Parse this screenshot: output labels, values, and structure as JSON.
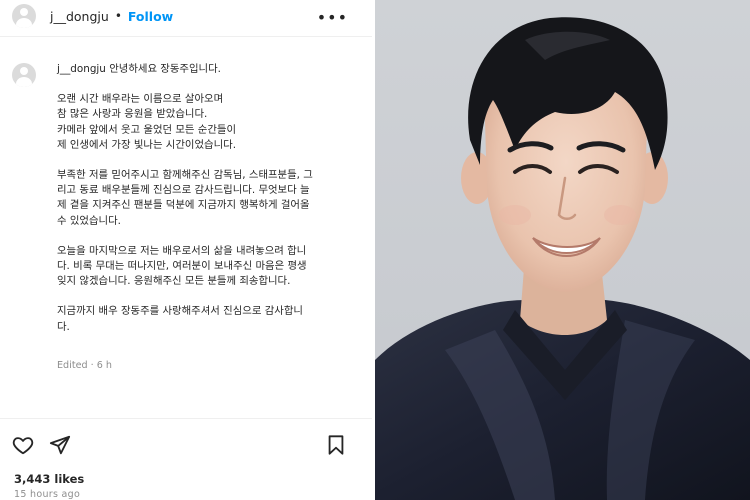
{
  "post": {
    "username": "j__dongju",
    "separator": "•",
    "follow_label": "Follow",
    "more_label": "•••",
    "caption_greeting": "안녕하세요 장동주입니다.",
    "paragraphs": [
      "오랜 시간 배우라는 이름으로 살아오며\n참 많은 사랑과 응원을 받았습니다.\n카메라 앞에서 웃고 울었던 모든 순간들이\n제 인생에서 가장 빛나는 시간이었습니다.",
      "부족한 저를 믿어주시고 함께해주신 감독님, 스태프분들, 그\n리고 동료 배우분들께 진심으로 감사드립니다. 무엇보다 늘\n제 곁을 지켜주신 팬분들 덕분에 지금까지 행복하게 걸어올\n수 있었습니다.",
      "오늘을 마지막으로 저는 배우로서의 삶을 내려놓으려 합니\n다. 비록 무대는 떠나지만, 여러분이 보내주신 마음은 평생\n잊지 않겠습니다. 응원해주신 모든 분들께 죄송합니다.",
      "지금까지 배우 장동주를 사랑해주셔서 진심으로 감사합니\n다."
    ],
    "edited": "Edited · 6 h",
    "likes": "3,443 likes",
    "time_ago": "15 hours ago"
  },
  "icons": {
    "avatar": "default-profile-icon",
    "like": "heart-icon",
    "share": "send-icon",
    "save": "bookmark-icon",
    "more": "more-options-icon"
  },
  "colors": {
    "accent": "#0095f6",
    "text": "#262626",
    "secondary": "#8e8e8e"
  }
}
